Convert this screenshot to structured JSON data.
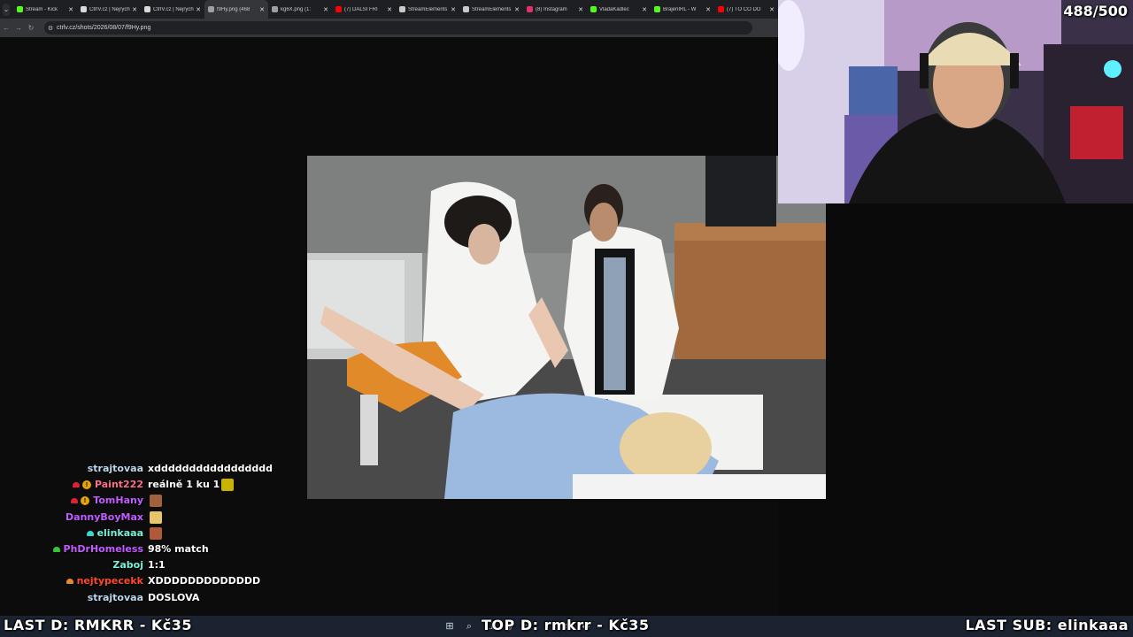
{
  "browser": {
    "tabs": [
      {
        "title": "Stream - Kick",
        "fav": "#53fc18",
        "active": false
      },
      {
        "title": "CtrlV.cz | Nejrychlejší",
        "fav": "#d9d9d9",
        "active": false
      },
      {
        "title": "CtrlV.cz | Nejrychlejší",
        "fav": "#d9d9d9",
        "active": false
      },
      {
        "title": "f9Hy.png (468",
        "fav": "#9aa0a6",
        "active": true
      },
      {
        "title": "kg6X.png (1:",
        "fav": "#9aa0a6",
        "active": false
      },
      {
        "title": "(7) DALŠÍ FRI",
        "fav": "#ff0000",
        "active": false
      },
      {
        "title": "StreamElements",
        "fav": "#c9c9c9",
        "active": false
      },
      {
        "title": "StreamElements",
        "fav": "#c9c9c9",
        "active": false
      },
      {
        "title": "(8) Instagram",
        "fav": "#e1306c",
        "active": false
      },
      {
        "title": "VladaKadlec",
        "fav": "#53fc18",
        "active": false
      },
      {
        "title": "BrajenIRL - W",
        "fav": "#53fc18",
        "active": false
      },
      {
        "title": "(7) TO ČO DO",
        "fav": "#ff0000",
        "active": false
      }
    ],
    "url": "ctrlv.cz/shots/2026/08/07/f9Hy.png",
    "icons": {
      "back": "arrow-left-icon",
      "forward": "arrow-right-icon",
      "reload": "reload-icon",
      "site_settings": "tune-icon",
      "tab_search": "chevron-down-icon",
      "close": "close-icon"
    }
  },
  "stream_overlay": {
    "sub_goal": "488/500",
    "last_donation": "LAST D: RMKRR - Kč35",
    "top_donation": "TOP D: rmkrr - Kč35",
    "last_sub": "LAST SUB: elinkaaa"
  },
  "chat": {
    "messages": [
      {
        "user": "strajtovaa",
        "color": "#bcd6ee",
        "badges": [],
        "text": "xddddddddddddddddd",
        "emotes": []
      },
      {
        "user": "Paint222",
        "color": "#ff6b8b",
        "badges": [
          "red",
          "gold"
        ],
        "text": "reálně 1 ku 1",
        "emotes": [
          "#c8b400"
        ]
      },
      {
        "user": "TomHany",
        "color": "#c15cff",
        "badges": [
          "red",
          "gold"
        ],
        "text": "",
        "emotes": [
          "#a0623a"
        ]
      },
      {
        "user": "DannyBoyMax",
        "color": "#c15cff",
        "badges": [],
        "text": "",
        "emotes": [
          "#e8c46a"
        ]
      },
      {
        "user": "elinkaaa",
        "color": "#7cf0d8",
        "badges": [
          "teal"
        ],
        "text": "",
        "emotes": [
          "#b05a38"
        ]
      },
      {
        "user": "PhDrHomeless",
        "color": "#c15cff",
        "badges": [
          "green"
        ],
        "text": "98% match",
        "emotes": []
      },
      {
        "user": "Zaboj",
        "color": "#7cf0d8",
        "badges": [],
        "text": "1:1",
        "emotes": []
      },
      {
        "user": "nejtypecekk",
        "color": "#ff4a2a",
        "badges": [
          "orange"
        ],
        "text": "XDDDDDDDDDDDDD",
        "emotes": []
      },
      {
        "user": "strajtovaa",
        "color": "#bcd6ee",
        "badges": [],
        "text": "DOSLOVA",
        "emotes": []
      }
    ]
  },
  "taskbar": {
    "icons": [
      "windows-start-icon",
      "search-icon",
      "task-view-icon",
      "chrome-icon",
      "file-explorer-icon",
      "edge-icon",
      "notepad-icon",
      "app-icon"
    ]
  }
}
